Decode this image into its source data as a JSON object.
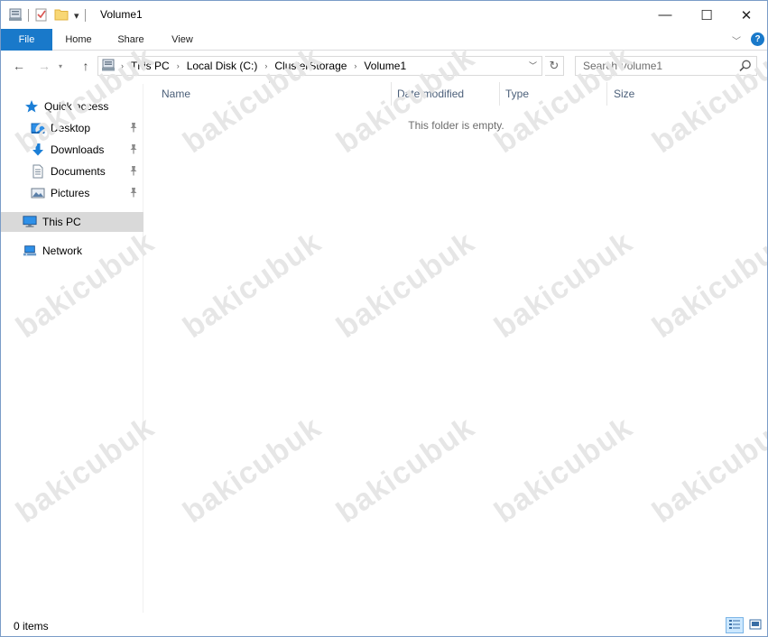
{
  "window": {
    "title": "Volume1",
    "minimize_glyph": "—",
    "maximize_glyph": "☐",
    "close_glyph": "✕"
  },
  "quick_access_toolbar": {
    "icons": [
      "properties-icon",
      "new-folder-icon",
      "customize-dropdown-icon"
    ],
    "dropdown_glyph": "▾"
  },
  "ribbon": {
    "tabs": [
      {
        "label": "File",
        "active": true
      },
      {
        "label": "Home"
      },
      {
        "label": "Share"
      },
      {
        "label": "View"
      }
    ],
    "expand_glyph": "﹀",
    "help_glyph": "?"
  },
  "navigation": {
    "back_glyph": "←",
    "forward_glyph": "→",
    "history_glyph": "▾",
    "up_glyph": "↑",
    "breadcrumb": [
      "This PC",
      "Local Disk (C:)",
      "ClusterStorage",
      "Volume1"
    ],
    "breadcrumb_sep": "›",
    "address_dropdown_glyph": "﹀",
    "refresh_glyph": "↻",
    "search_placeholder": "Search Volume1"
  },
  "sidebar": {
    "quick_access": {
      "label": "Quick access",
      "icon": "star-icon"
    },
    "pinned": [
      {
        "label": "Desktop",
        "icon": "desktop-folder-icon"
      },
      {
        "label": "Downloads",
        "icon": "downloads-icon"
      },
      {
        "label": "Documents",
        "icon": "documents-icon"
      },
      {
        "label": "Pictures",
        "icon": "pictures-icon"
      }
    ],
    "pin_glyph": "📌",
    "this_pc": {
      "label": "This PC",
      "icon": "computer-icon",
      "selected": true
    },
    "network": {
      "label": "Network",
      "icon": "network-icon"
    }
  },
  "columns": [
    {
      "label": "Name",
      "sorted": "ascending"
    },
    {
      "label": "Date modified"
    },
    {
      "label": "Type"
    },
    {
      "label": "Size"
    }
  ],
  "sort_glyph": "^",
  "empty_message": "This folder is empty.",
  "status": {
    "item_count": "0 items",
    "active_view": "details"
  },
  "watermark": "bakicubuk",
  "colors": {
    "accent": "#1979ca",
    "selection": "#d9d9d9",
    "column_header_text": "#4c607a"
  }
}
